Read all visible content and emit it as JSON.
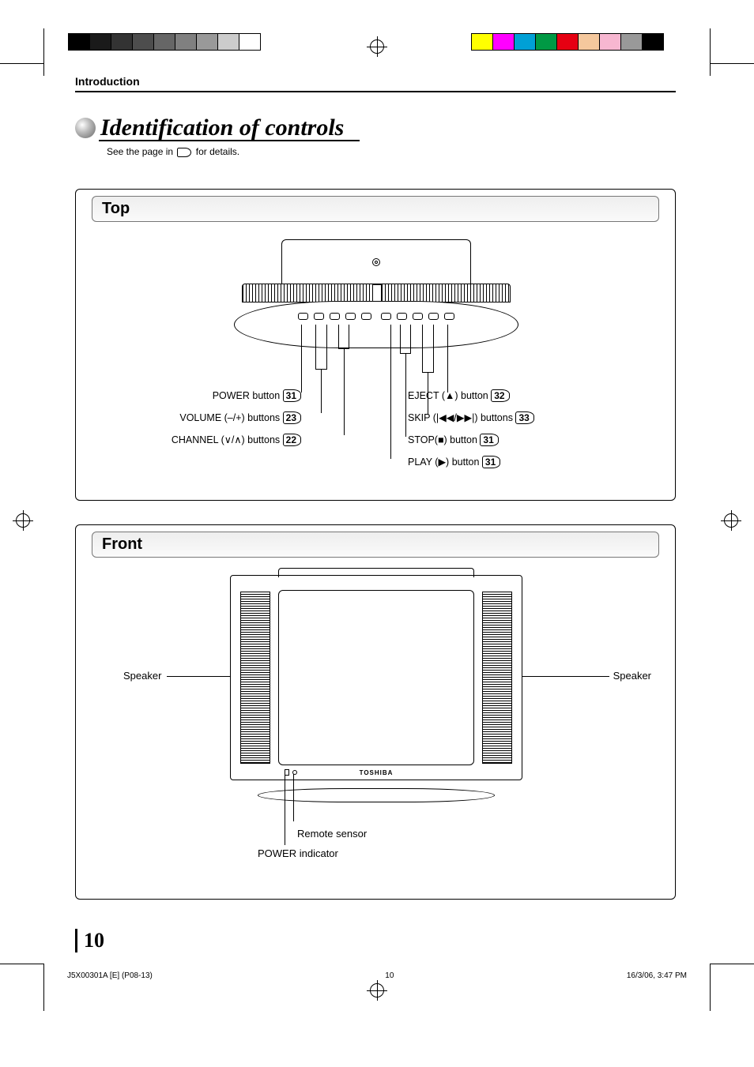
{
  "chapter": "Introduction",
  "title": "Identification of controls",
  "subnote_before": "See the page in",
  "subnote_after": "for details.",
  "sections": {
    "top": {
      "title": "Top",
      "left_callouts": [
        {
          "label": "POWER button",
          "page": "31"
        },
        {
          "label": "VOLUME (–/+) buttons",
          "page": "23"
        },
        {
          "label": "CHANNEL (∨/∧) buttons",
          "page": "22"
        }
      ],
      "right_callouts": [
        {
          "label": "EJECT (▲) button",
          "page": "32"
        },
        {
          "label": "SKIP (|◀◀/▶▶|) buttons",
          "page": "33"
        },
        {
          "label": "STOP(■) button",
          "page": "31"
        },
        {
          "label": "PLAY (▶) button",
          "page": "31"
        }
      ]
    },
    "front": {
      "title": "Front",
      "speaker_left": "Speaker",
      "speaker_right": "Speaker",
      "remote_sensor": "Remote sensor",
      "power_indicator": "POWER indicator",
      "brand": "TOSHIBA"
    }
  },
  "page_number": "10",
  "footer": {
    "doc_id": "J5X00301A [E] (P08-13)",
    "page": "10",
    "datetime": "16/3/06, 3:47 PM"
  },
  "color_bars_left": [
    "#000",
    "#1a1a1a",
    "#333",
    "#4d4d4d",
    "#666",
    "#808080",
    "#999",
    "#ccc",
    "#fff"
  ],
  "color_bars_right": [
    "#ffff00",
    "#ff00ff",
    "#00a0d6",
    "#009944",
    "#e60012",
    "#f5c89d",
    "#f7b7d1",
    "#999",
    "#000"
  ]
}
